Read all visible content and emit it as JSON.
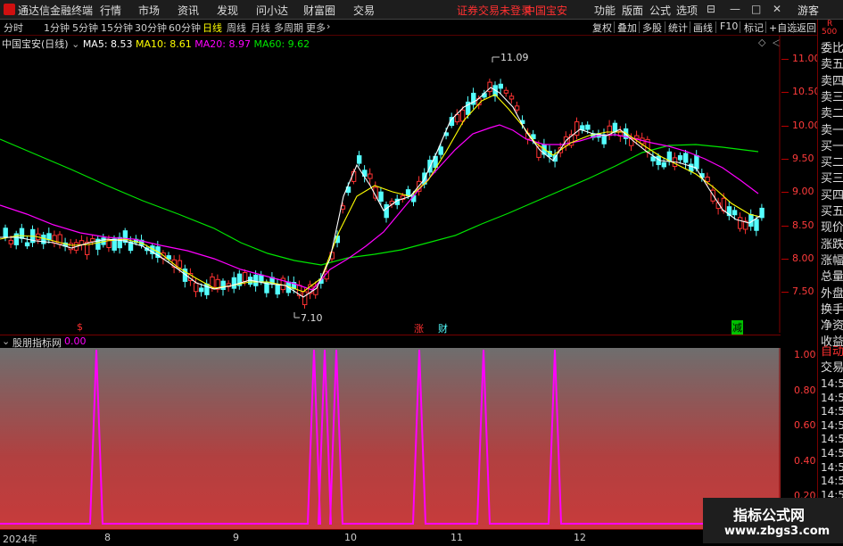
{
  "app": {
    "title": "通达信金融终端"
  },
  "menu": [
    "行情",
    "市场",
    "资讯",
    "发现",
    "问小达",
    "财富圈",
    "交易"
  ],
  "status": {
    "login": "证券交易未登录",
    "stock": "中国宝安"
  },
  "right_menu": [
    "功能",
    "版面",
    "公式",
    "选项"
  ],
  "user": "游客",
  "periods": [
    "分时",
    "1分钟",
    "5分钟",
    "15分钟",
    "30分钟",
    "60分钟",
    "日线",
    "周线",
    "月线",
    "多周期",
    "更多"
  ],
  "toolbar_right": [
    "复权",
    "叠加",
    "多股",
    "统计",
    "画线",
    "F10",
    "标记",
    "+自选",
    "返回"
  ],
  "corner": {
    "r": "R",
    "num": "500"
  },
  "legend": {
    "name": "中国宝安(日线)",
    "ma5": "MA5: 8.53",
    "ma10": "MA10: 8.61",
    "ma20": "MA20: 8.97",
    "ma60": "MA60: 9.62"
  },
  "price_axis": [
    "11.00",
    "10.50",
    "10.00",
    "9.50",
    "9.00",
    "8.50",
    "8.00",
    "7.50"
  ],
  "annot": {
    "high": "11.09",
    "low": "7.10",
    "m1": "$",
    "m2": "涨",
    "m3": "财",
    "m4": "减"
  },
  "quote_labels": [
    "委比",
    "卖五",
    "卖四",
    "卖三",
    "卖二",
    "卖一",
    "买一",
    "买二",
    "买三",
    "买四",
    "买五",
    "现价",
    "涨跌",
    "涨幅",
    "总量",
    "外盘",
    "换手",
    "净资",
    "收益"
  ],
  "indicator": {
    "name": "股朋指标网",
    "value": "0.00",
    "axis": [
      "1.00",
      "0.80",
      "0.60",
      "0.40",
      "0.20"
    ]
  },
  "rpanel2": {
    "auto": "自动",
    "trade": "交易",
    "times": [
      "14:5",
      "14:5",
      "14:5",
      "14:5",
      "14:5",
      "14:5",
      "14:5",
      "14:5",
      "14:5",
      "14:5",
      "14:5"
    ]
  },
  "dates": [
    "2024年",
    "8",
    "9",
    "10",
    "11",
    "12"
  ],
  "watermark": {
    "title": "指标公式网",
    "url": "www.zbgs3.com"
  },
  "colors": {
    "up": "#ff3232",
    "down": "#54ffff",
    "ma5": "#ffffff",
    "ma10": "#ffff00",
    "ma20": "#ff00ff",
    "ma60": "#00e600",
    "spike": "#ff00ff"
  }
}
